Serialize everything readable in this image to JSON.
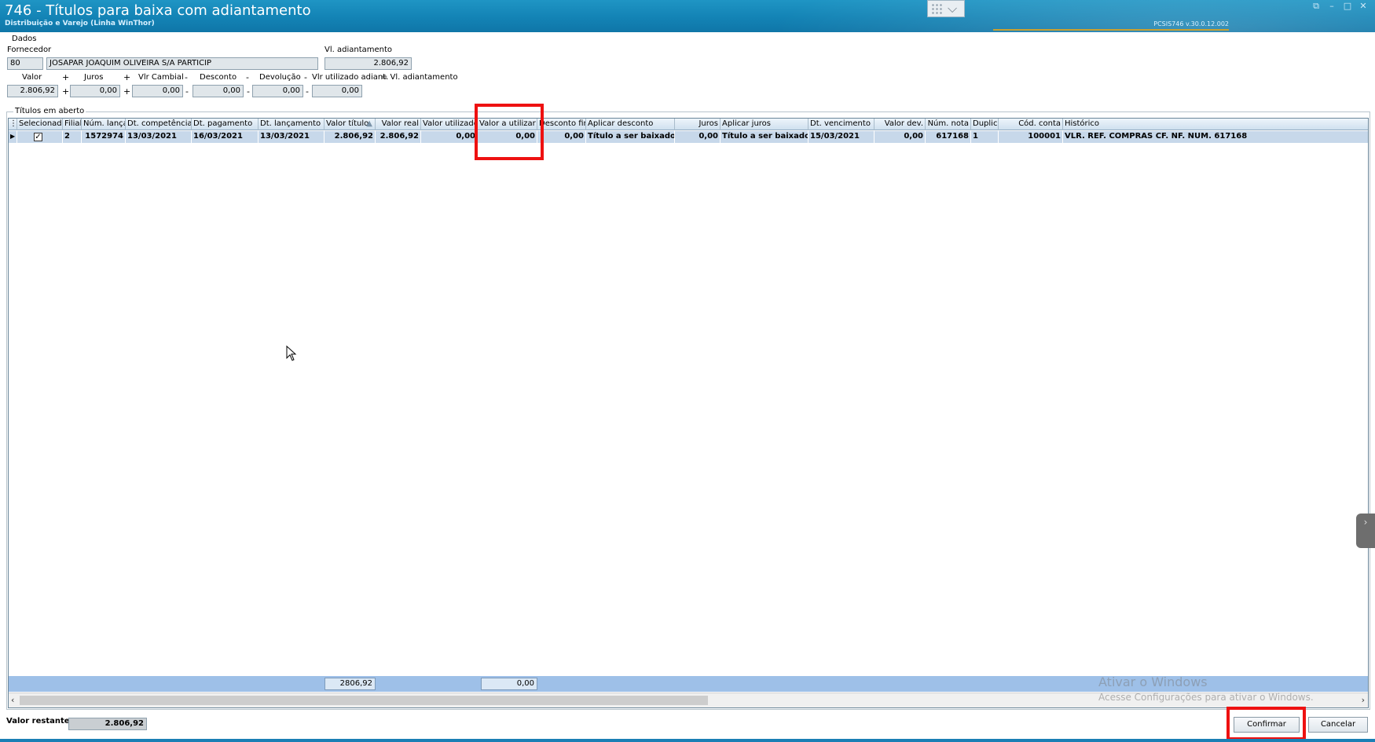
{
  "window": {
    "title": "746 - Títulos para baixa com adiantamento",
    "subtitle": "Distribuição e Varejo (Linha WinThor)",
    "version": "PCSIS746  v.30.0.12.002"
  },
  "dados": {
    "section_label": "Dados",
    "fornecedor_label": "Fornecedor",
    "fornecedor_code": "80",
    "fornecedor_name": "JOSAPAR JOAQUIM OLIVEIRA S/A PARTICIP",
    "vl_adiantamento_label": "Vl. adiantamento",
    "vl_adiantamento_value": "2.806,92",
    "valor_label": "Valor",
    "valor_value": "2.806,92",
    "op1": "+",
    "juros_label": "Juros",
    "juros_value": "0,00",
    "op2": "+",
    "vlr_cambial_label": "Vlr Cambial",
    "vlr_cambial_value": "0,00",
    "op3": "-",
    "desconto_label": "Desconto",
    "desconto_value": "0,00",
    "op4": "-",
    "devolucao_label": "Devolução",
    "devolucao_value": "0,00",
    "op5": "-",
    "vlr_utilizado_label": "Vlr utilizado adiant.",
    "vlr_utilizado_value": "0,00",
    "equals_label": "= Vl. adiantamento"
  },
  "titulos": {
    "section_label": "Títulos em aberto",
    "columns": [
      "Selecionado",
      "Filial",
      "Núm. lançar",
      "Dt. competência",
      "Dt. pagamento",
      "Dt. lançamento",
      "Valor título",
      "Valor real",
      "Valor utilizado",
      "Valor a utilizar",
      "Desconto fin.",
      "Aplicar desconto",
      "Juros",
      "Aplicar juros",
      "Dt. vencimento",
      "Valor dev.",
      "Núm. nota",
      "Duplic",
      "Cód. conta",
      "Histórico"
    ],
    "rows": [
      {
        "selected": "✓",
        "filial": "2",
        "num_lanc": "1572974",
        "dt_competencia": "13/03/2021",
        "dt_pagamento": "16/03/2021",
        "dt_lancamento": "13/03/2021",
        "valor_titulo": "2.806,92",
        "valor_real": "2.806,92",
        "valor_utilizado": "0,00",
        "valor_a_utilizar": "0,00",
        "desconto_fin": "0,00",
        "aplicar_desconto": "Título a ser baixado",
        "juros": "0,00",
        "aplicar_juros": "Título a ser baixado",
        "dt_vencimento": "15/03/2021",
        "valor_dev": "0,00",
        "num_nota": "617168",
        "duplic": "1",
        "cod_conta": "100001",
        "historico": "VLR. REF. COMPRAS CF. NF. NUM. 617168"
      }
    ],
    "totals": {
      "valor_titulo": "2806,92",
      "valor_a_utilizar": "0,00"
    }
  },
  "watermark": {
    "line1": "Ativar o Windows",
    "line2": "Acesse Configurações para ativar o Windows."
  },
  "bottom": {
    "valor_restante_label": "Valor restante",
    "valor_restante_value": "2.806,92",
    "confirm_label": "Confirmar",
    "cancel_label": "Cancelar"
  },
  "icons": [
    "grid-menu-icon",
    "chevron-down-icon",
    "restore-icon",
    "minimize-icon",
    "maximize-icon",
    "close-icon",
    "row-indicator-icon",
    "sort-icon",
    "scroll-left-icon",
    "scroll-right-icon",
    "side-panel-toggle-icon",
    "mouse-cursor-icon"
  ],
  "colors": {
    "titlebar": "#1383b5",
    "selected_row": "#c7d8ea",
    "footer": "#9ec0e8",
    "highlight": "#ee1111"
  }
}
